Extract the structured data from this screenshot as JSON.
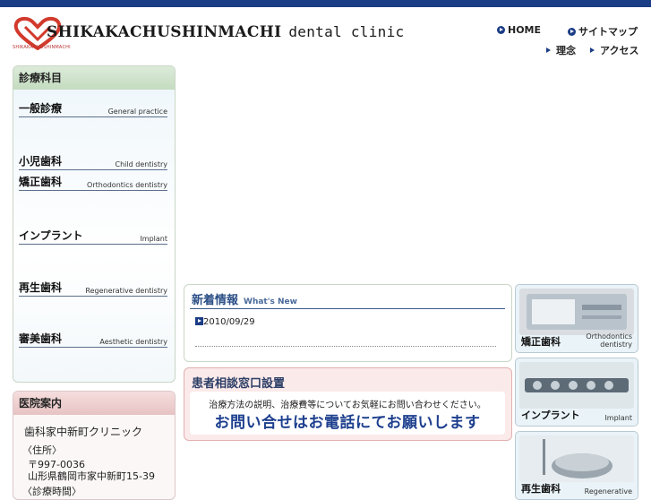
{
  "header": {
    "brand": "SHIKAKACHUSHINMACHI",
    "brand_sub": "dental clinic",
    "logo_caption": "SHIKAKACHUSHINMACHI",
    "nav": {
      "home": "HOME",
      "sitemap": "サイトマップ",
      "philosophy": "理念",
      "access": "アクセス"
    }
  },
  "sidebar": {
    "departments_title": "診療科目",
    "items": [
      {
        "jp": "一般診療",
        "en": "General practice"
      },
      {
        "jp": "小児歯科",
        "en": "Child dentistry"
      },
      {
        "jp": "矯正歯科",
        "en": "Orthodontics dentistry"
      },
      {
        "jp": "インプラント",
        "en": "Implant"
      },
      {
        "jp": "再生歯科",
        "en": "Regenerative dentistry"
      },
      {
        "jp": "審美歯科",
        "en": "Aesthetic dentistry"
      }
    ],
    "info_title": "医院案内",
    "clinic_name": "歯科家中新町クリニック",
    "address_label": "〈住所〉",
    "postal": "〒997-0036",
    "address": "山形県鶴岡市家中新町15-39",
    "hours_label": "〈診療時間〉"
  },
  "news": {
    "title": "新着情報",
    "title_en": "What's New",
    "entry_date": "2010/09/29"
  },
  "consult": {
    "title": "患者相談窓口設置",
    "description": "治療方法の説明、治療費等についてお気軽にお問い合わせください。",
    "call_to_action": "お問い合せはお電話にてお願いします"
  },
  "cards": [
    {
      "jp": "矯正歯科",
      "en_line1": "Orthodontics",
      "en_line2": "dentistry"
    },
    {
      "jp": "インプラント",
      "en_line1": "Implant",
      "en_line2": ""
    },
    {
      "jp": "再生歯科",
      "en_line1": "Regenerative",
      "en_line2": ""
    }
  ],
  "colors": {
    "accent_navy": "#1b3d86",
    "side_header_green": "#c4dcc0",
    "side_header_pink": "#e7c3c3",
    "cta_blue": "#1d3f8e"
  }
}
